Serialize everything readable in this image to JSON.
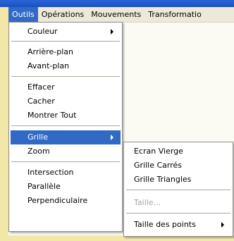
{
  "menubar": {
    "items": [
      "Outils",
      "Opérations",
      "Mouvements",
      "Transformatio"
    ]
  },
  "outils_menu": {
    "couleur": "Couleur",
    "arriere_plan": "Arrière-plan",
    "avant_plan": "Avant-plan",
    "effacer": "Effacer",
    "cacher": "Cacher",
    "montrer_tout": "Montrer Tout",
    "grille": "Grille",
    "zoom": "Zoom",
    "intersection": "Intersection",
    "parallele": "Parallèle",
    "perpendiculaire": "Perpendiculaire"
  },
  "grille_submenu": {
    "ecran_vierge": "Ecran Vierge",
    "grille_carres": "Grille Carrés",
    "grille_triangles": "Grille Triangles",
    "taille": "Taille...",
    "taille_des_points": "Taille des points"
  },
  "colors": {
    "selection": "#316ac5",
    "menubar_bg": "#ece9d8",
    "disabled_text": "#a7a6aa"
  }
}
